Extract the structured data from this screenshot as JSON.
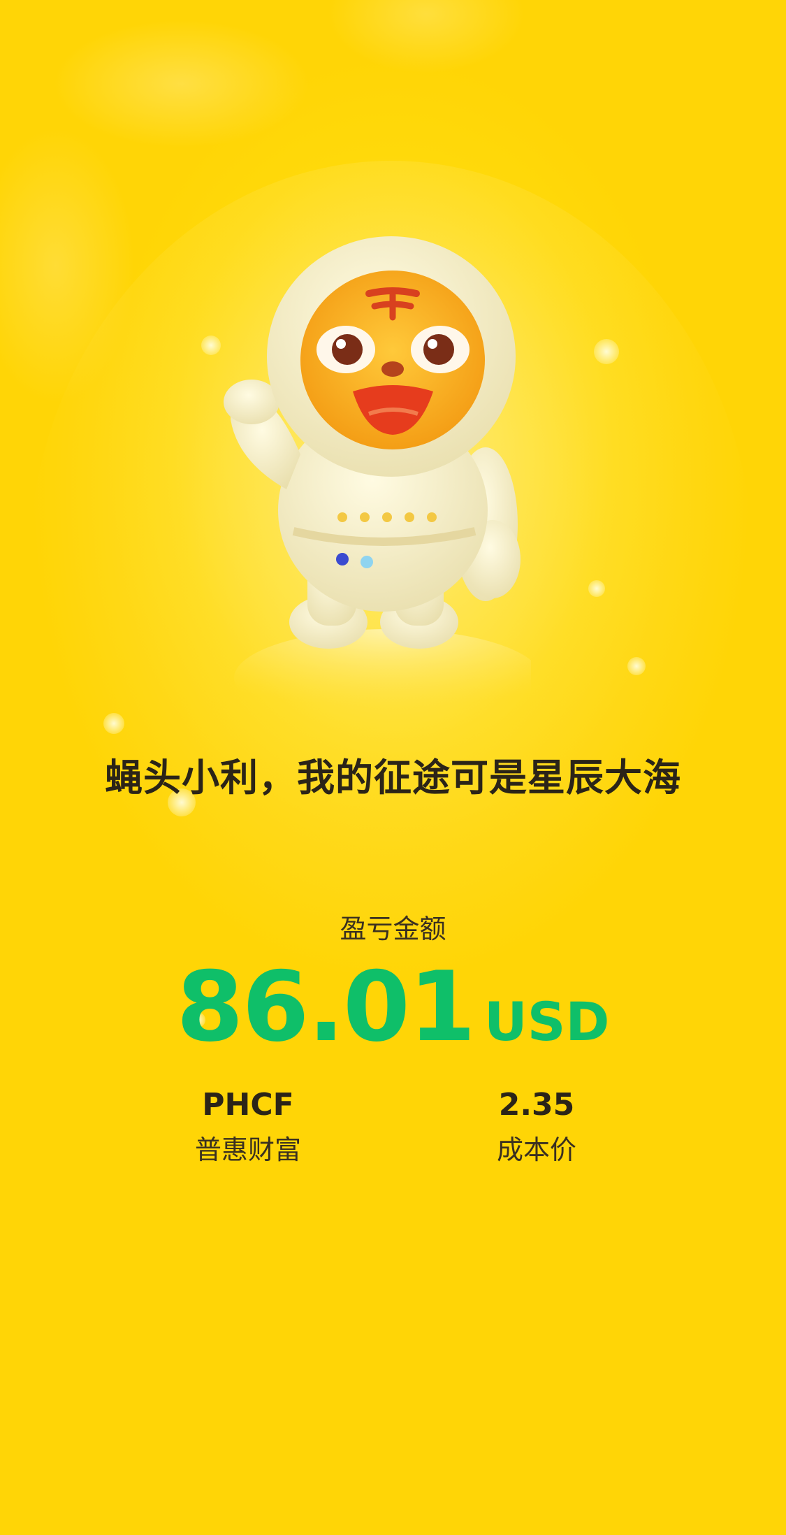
{
  "hero": {
    "slogan": "蝇头小利，我的征途可是星辰大海"
  },
  "pnl": {
    "label": "盈亏金额",
    "amount": "86.01",
    "currency": "USD",
    "amount_color": "#0fbf69"
  },
  "stats": {
    "stock_code": "PHCF",
    "stock_name": "普惠财富",
    "cost_price": "2.35",
    "cost_price_label": "成本价"
  },
  "theme": {
    "background": "#ffd90a",
    "text": "#2b2418"
  },
  "icons": {
    "mascot": "tiger-astronaut-mascot"
  }
}
